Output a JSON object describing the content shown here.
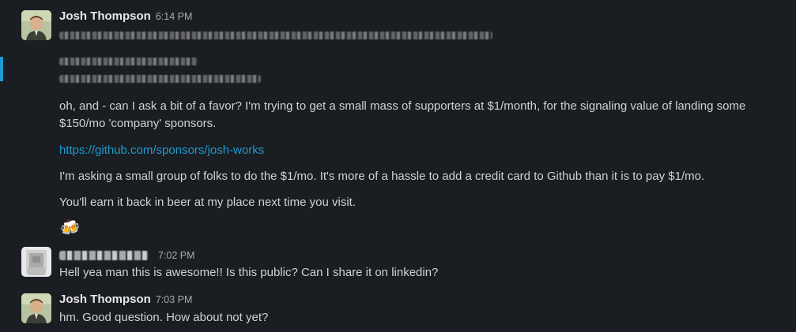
{
  "messages": [
    {
      "sender": "Josh Thompson",
      "time": "6:14 PM",
      "paragraphs": [
        "oh, and - can I ask a bit of a favor? I'm trying to get a small mass of supporters at $1/month, for the signaling value of landing some $150/mo 'company' sponsors."
      ],
      "link": "https://github.com/sponsors/josh-works",
      "paragraphs_after": [
        "I'm asking a small group of folks to do the $1/mo. It's more of a hassle to add a credit card to Github than it is to pay $1/mo.",
        "You'll earn it back in beer at my place next time you visit."
      ],
      "reaction_emoji": "🍻"
    },
    {
      "sender": "",
      "time": "7:02 PM",
      "text": "Hell yea man this is awesome!! Is this public? Can I share it on linkedin?"
    },
    {
      "sender": "Josh Thompson",
      "time": "7:03 PM",
      "text": "hm. Good question. How about not yet?"
    }
  ],
  "colors": {
    "background": "#1a1d21",
    "link": "#1d9bd1",
    "text": "#d1d2d3",
    "timestamp": "#ababad",
    "accent_bar": "#1d9bd1"
  },
  "icons": {
    "avatar_josh": "avatar-josh",
    "avatar_other": "avatar-blurred",
    "reaction": "beer-mugs-icon"
  }
}
